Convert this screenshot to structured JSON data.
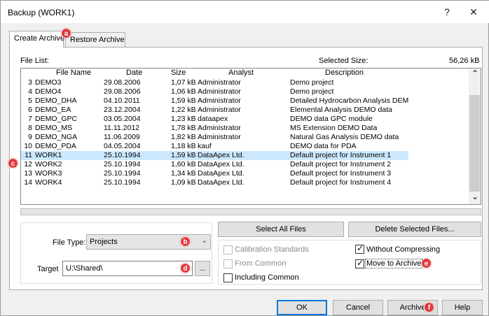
{
  "window": {
    "title": "Backup (WORK1)",
    "help_glyph": "?",
    "close_glyph": "✕"
  },
  "tabs": [
    {
      "label": "Create Archive"
    },
    {
      "label": "Restore Archive"
    }
  ],
  "file_list": {
    "label": "File List:",
    "selected_size_label": "Selected Size:",
    "selected_size_value": "56,26 kB",
    "columns": [
      "File Name",
      "Date",
      "Size",
      "Analyst",
      "Description"
    ],
    "rows": [
      {
        "num": "3",
        "name": "DEMO3",
        "date": "29.08.2006",
        "size": "1,07 kB",
        "analyst": "Administrator",
        "desc": "Demo project"
      },
      {
        "num": "4",
        "name": "DEMO4",
        "date": "29.08.2006",
        "size": "1,06 kB",
        "analyst": "Administrator",
        "desc": "Demo project"
      },
      {
        "num": "5",
        "name": "DEMO_DHA",
        "date": "04.10.2011",
        "size": "1,59 kB",
        "analyst": "Administrator",
        "desc": "Detailed Hydrocarbon Analysis DEM"
      },
      {
        "num": "6",
        "name": "DEMO_EA",
        "date": "23.12.2004",
        "size": "1,22 kB",
        "analyst": "Administrator",
        "desc": "Elemental Analysis DEMO data"
      },
      {
        "num": "7",
        "name": "DEMO_GPC",
        "date": "03.05.2004",
        "size": "1,23 kB",
        "analyst": "dataapex",
        "desc": "DEMO data GPC module"
      },
      {
        "num": "8",
        "name": "DEMO_MS",
        "date": "11.11.2012",
        "size": "1,78 kB",
        "analyst": "Administrator",
        "desc": "MS Extension DEMO Data"
      },
      {
        "num": "9",
        "name": "DEMO_NGA",
        "date": "11.06.2009",
        "size": "1,82 kB",
        "analyst": "Administrator",
        "desc": "Natural Gas Analysis DEMO data"
      },
      {
        "num": "10",
        "name": "DEMO_PDA",
        "date": "04.05.2004",
        "size": "1,18 kB",
        "analyst": "kauf",
        "desc": "DEMO data for PDA"
      },
      {
        "num": "11",
        "name": "WORK1",
        "date": "25.10.1994",
        "size": "1,59 kB",
        "analyst": "DataApex Ltd.",
        "desc": "Default project for Instrument 1"
      },
      {
        "num": "12",
        "name": "WORK2",
        "date": "25.10.1994",
        "size": "1,60 kB",
        "analyst": "DataApex Ltd.",
        "desc": "Default project for Instrument 2"
      },
      {
        "num": "13",
        "name": "WORK3",
        "date": "25.10.1994",
        "size": "1,34 kB",
        "analyst": "DataApex Ltd.",
        "desc": "Default project for Instrument 3"
      },
      {
        "num": "14",
        "name": "WORK4",
        "date": "25.10.1994",
        "size": "1,09 kB",
        "analyst": "DataApex Ltd.",
        "desc": "Default project for Instrument 4"
      }
    ]
  },
  "file_type": {
    "label": "File Type:",
    "value": "Projects"
  },
  "target": {
    "label": "Target",
    "value": "U:\\Shared\\",
    "browse_label": "..."
  },
  "actions": {
    "select_all": "Select All Files",
    "delete_selected": "Delete Selected Files..."
  },
  "checkboxes": {
    "calibration_standards": {
      "label": "Calibration Standards",
      "checked": false,
      "disabled": true
    },
    "from_common": {
      "label": "From Common",
      "checked": false,
      "disabled": true
    },
    "including_common": {
      "label": "Including Common",
      "checked": false,
      "disabled": false
    },
    "without_compressing": {
      "label": "Without Compressing",
      "checked": true,
      "disabled": false
    },
    "move_to_archive": {
      "label": "Move to Archive",
      "checked": true,
      "disabled": false
    }
  },
  "footer": {
    "ok": "OK",
    "cancel": "Cancel",
    "archive": "Archive",
    "help": "Help"
  },
  "badges": {
    "a": "a",
    "b": "b",
    "c": "c",
    "d": "d",
    "e": "e",
    "f": "f"
  },
  "scroll": {
    "up_glyph": "⌃",
    "down_glyph": "⌄"
  },
  "colors": {
    "selection": "#cce8ff",
    "badge": "#e0383e",
    "default_button_border": "#0078d7"
  }
}
